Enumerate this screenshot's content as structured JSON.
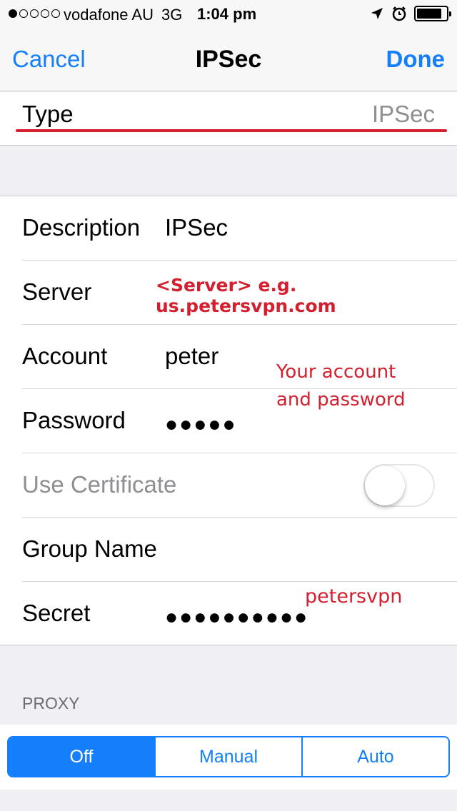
{
  "status_bar": {
    "signal_dots_filled": 1,
    "signal_dots_total": 5,
    "carrier": "vodafone AU",
    "network": "3G",
    "time": "1:04 pm",
    "icons": [
      "location-arrow-icon",
      "alarm-clock-icon",
      "battery-icon"
    ]
  },
  "nav": {
    "cancel_label": "Cancel",
    "title": "IPSec",
    "done_label": "Done"
  },
  "type_row": {
    "label": "Type",
    "value": "IPSec"
  },
  "form": {
    "description": {
      "label": "Description",
      "value": "IPSec"
    },
    "server": {
      "label": "Server",
      "value": ""
    },
    "account": {
      "label": "Account",
      "value": "peter"
    },
    "password": {
      "label": "Password",
      "masked": "●●●●●"
    },
    "use_certificate": {
      "label": "Use Certificate",
      "enabled": false
    },
    "group_name": {
      "label": "Group Name",
      "value": ""
    },
    "secret": {
      "label": "Secret",
      "masked": "●●●●●●●●●●"
    }
  },
  "annotations": {
    "server": "<Server> e.g. us.petersvpn.com",
    "account_line1": "Your account",
    "account_line2": "and password",
    "secret": "petersvpn"
  },
  "proxy": {
    "header": "PROXY",
    "options": [
      "Off",
      "Manual",
      "Auto"
    ],
    "selected": "Off"
  },
  "colors": {
    "accent": "#147efb",
    "annotation_red": "#d41f2f",
    "background": "#efeff4",
    "secondary_text": "#8e8e93"
  }
}
